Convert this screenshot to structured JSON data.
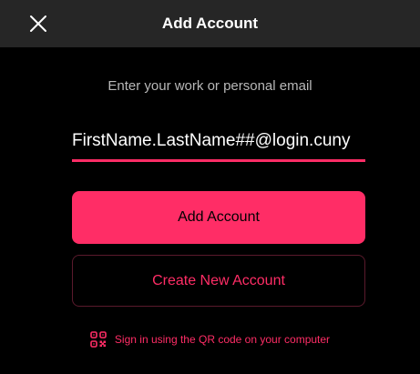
{
  "header": {
    "title": "Add Account",
    "close_icon": "close-icon"
  },
  "form": {
    "prompt": "Enter your work or personal email",
    "email_value": "FirstName.LastName##@login.cuny"
  },
  "buttons": {
    "add_account": "Add Account",
    "create_account": "Create New Account"
  },
  "qr": {
    "icon": "qr-code-icon",
    "text": "Sign in using the QR code on your computer"
  },
  "colors": {
    "accent": "#ff2d66",
    "header_bg": "#262626",
    "background": "#000000",
    "prompt_text": "#b8b8b8"
  }
}
